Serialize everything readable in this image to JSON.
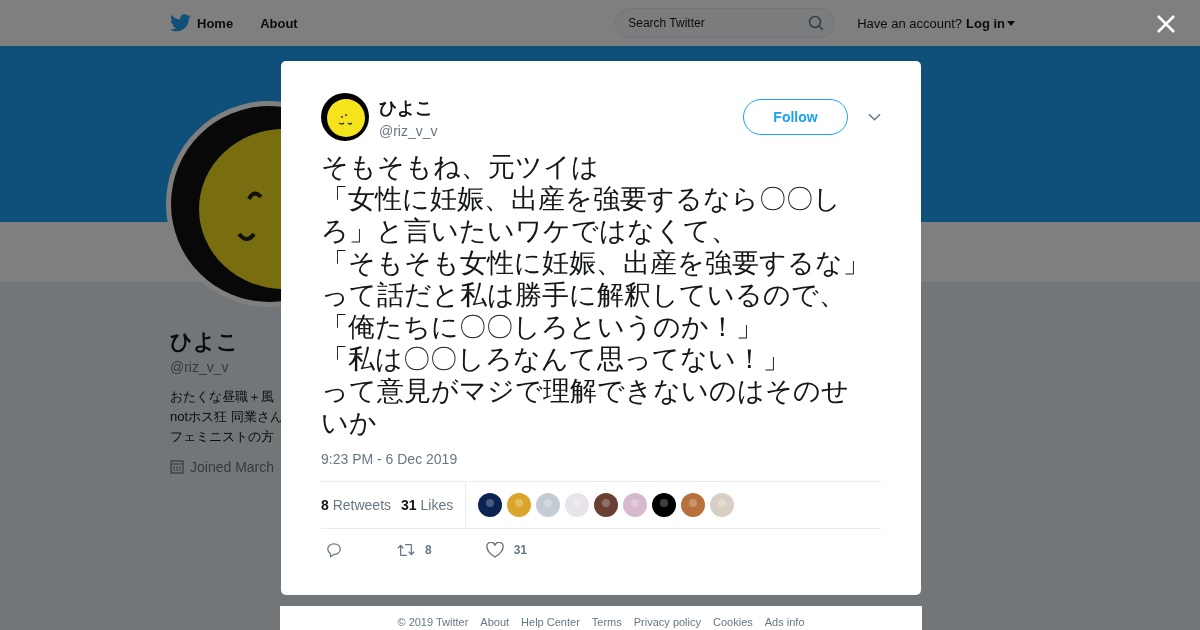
{
  "nav": {
    "items": [
      {
        "label": "Home"
      },
      {
        "label": "About"
      }
    ],
    "search": {
      "placeholder": "Search Twitter"
    },
    "account_prompt": "Have an account?",
    "login": "Log in"
  },
  "profile": {
    "name": "ひよこ",
    "handle": "@riz_v_v",
    "bio": [
      "おたくな昼職＋風",
      "notホス狂 同業さん",
      "フェミニストの方"
    ],
    "joined": "Joined March"
  },
  "tweet": {
    "author": "ひよこ",
    "handle": "@riz_v_v",
    "follow": "Follow",
    "text": [
      "そもそもね、元ツイは",
      "「女性に妊娠、出産を強要するなら〇〇し",
      "ろ」と言いたいワケではなくて、",
      "「そもそも女性に妊娠、出産を強要するな」",
      "って話だと私は勝手に解釈しているので、",
      "「俺たちに〇〇しろというのか！」",
      "「私は〇〇しろなんて思ってない！」",
      "って意見がマジで理解できないのはそのせ",
      "いか"
    ],
    "time": "9:23 PM - 6 Dec 2019",
    "retweets": "8",
    "retweets_label": "Retweets",
    "likes": "31",
    "likes_label": "Likes",
    "action_retweets": "8",
    "action_likes": "31"
  },
  "footer": [
    "© 2019 Twitter",
    "About",
    "Help Center",
    "Terms",
    "Privacy policy",
    "Cookies",
    "Ads info"
  ]
}
